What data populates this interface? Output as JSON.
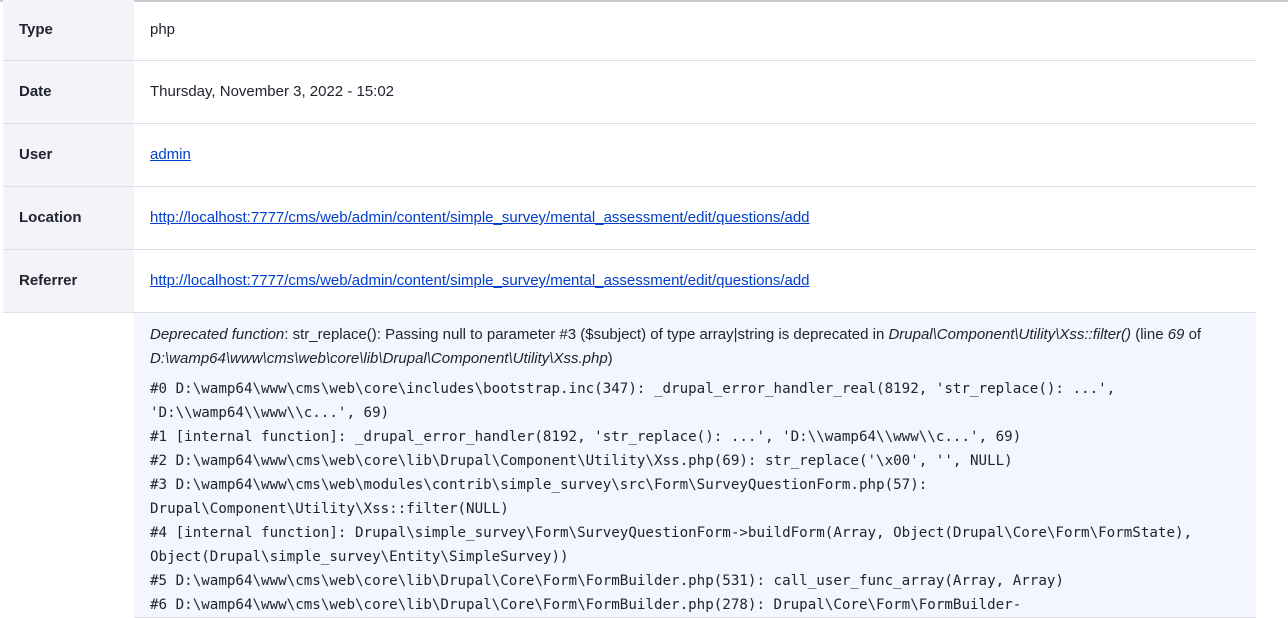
{
  "rows": {
    "type": {
      "label": "Type",
      "value": "php"
    },
    "date": {
      "label": "Date",
      "value": "Thursday, November 3, 2022 - 15:02"
    },
    "user": {
      "label": "User",
      "value": "admin"
    },
    "location": {
      "label": "Location",
      "value": "http://localhost:7777/cms/web/admin/content/simple_survey/mental_assessment/edit/questions/add"
    },
    "referrer": {
      "label": "Referrer",
      "value": "http://localhost:7777/cms/web/admin/content/simple_survey/mental_assessment/edit/questions/add"
    }
  },
  "message": {
    "func_em": "Deprecated function",
    "text1": ": str_replace(): Passing null to parameter #3 ($subject) of type array|string is deprecated in ",
    "class_em": "Drupal\\Component\\Utility\\Xss::filter()",
    "text2": " (line ",
    "line_em": "69",
    "text3": " of ",
    "file_em": "D:\\wamp64\\www\\cms\\web\\core\\lib\\Drupal\\Component\\Utility\\Xss.php",
    "text4": ")"
  },
  "trace": [
    "#0 D:\\wamp64\\www\\cms\\web\\core\\includes\\bootstrap.inc(347): _drupal_error_handler_real(8192, 'str_replace(): ...', 'D:\\\\wamp64\\\\www\\\\c...', 69)",
    "#1 [internal function]: _drupal_error_handler(8192, 'str_replace(): ...', 'D:\\\\wamp64\\\\www\\\\c...', 69)",
    "#2 D:\\wamp64\\www\\cms\\web\\core\\lib\\Drupal\\Component\\Utility\\Xss.php(69): str_replace('\\x00', '', NULL)",
    "#3 D:\\wamp64\\www\\cms\\web\\modules\\contrib\\simple_survey\\src\\Form\\SurveyQuestionForm.php(57): Drupal\\Component\\Utility\\Xss::filter(NULL)",
    "#4 [internal function]: Drupal\\simple_survey\\Form\\SurveyQuestionForm->buildForm(Array, Object(Drupal\\Core\\Form\\FormState), Object(Drupal\\simple_survey\\Entity\\SimpleSurvey))",
    "#5 D:\\wamp64\\www\\cms\\web\\core\\lib\\Drupal\\Core\\Form\\FormBuilder.php(531): call_user_func_array(Array, Array)",
    "#6 D:\\wamp64\\www\\cms\\web\\core\\lib\\Drupal\\Core\\Form\\FormBuilder.php(278): Drupal\\Core\\Form\\FormBuilder-"
  ]
}
